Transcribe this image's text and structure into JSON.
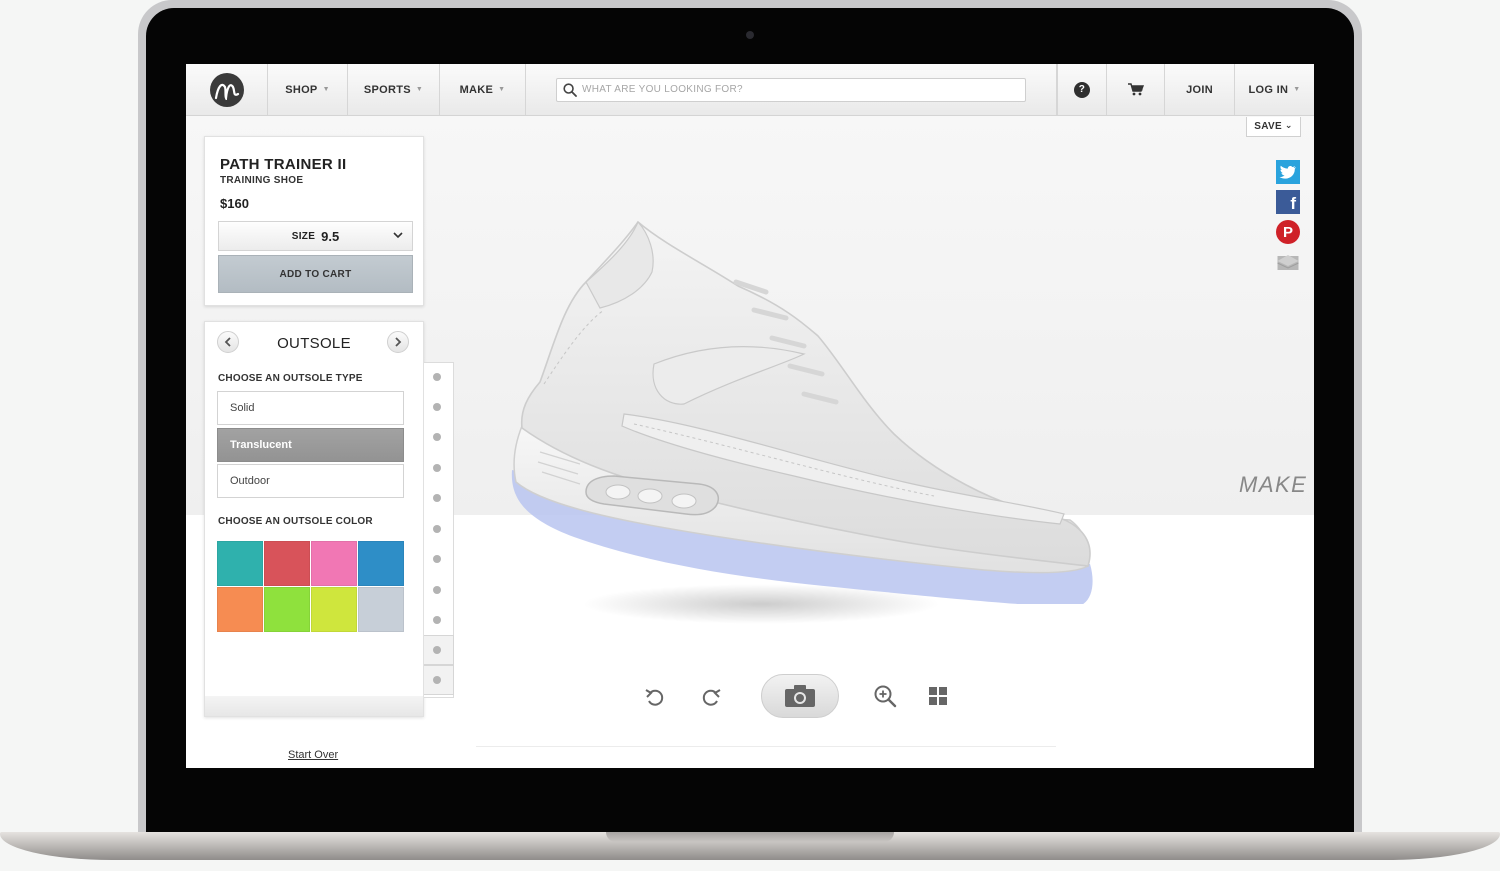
{
  "nav": {
    "items": [
      "SHOP",
      "SPORTS",
      "MAKE"
    ],
    "search_placeholder": "WHAT ARE YOU LOOKING FOR?",
    "help_icon": "?",
    "join": "JOIN",
    "login": "LOG IN",
    "save": "SAVE"
  },
  "product": {
    "name": "PATH TRAINER II",
    "type": "TRAINING SHOE",
    "price": "$160",
    "size_label": "SIZE",
    "size_value": "9.5",
    "add_to_cart": "ADD TO CART"
  },
  "customizer": {
    "panel_title": "OUTSOLE",
    "type_label": "CHOOSE AN OUTSOLE TYPE",
    "types": [
      "Solid",
      "Translucent",
      "Outdoor"
    ],
    "selected_type": "Translucent",
    "color_label": "CHOOSE AN OUTSOLE COLOR",
    "colors": [
      "#2fb1ad",
      "#d8535a",
      "#f177b4",
      "#2e8ec7",
      "#f68c52",
      "#8fe13d",
      "#cfe63d",
      "#c7cfd8"
    ]
  },
  "share": [
    "twitter-icon",
    "facebook-icon",
    "pinterest-icon",
    "email-icon"
  ],
  "watermark": "MAKE",
  "start_over": "Start Over",
  "colors": {
    "accent_button": "#b9c2c9",
    "selected_option": "#9c9c9c",
    "sole_highlight": "#b8c4f0"
  }
}
